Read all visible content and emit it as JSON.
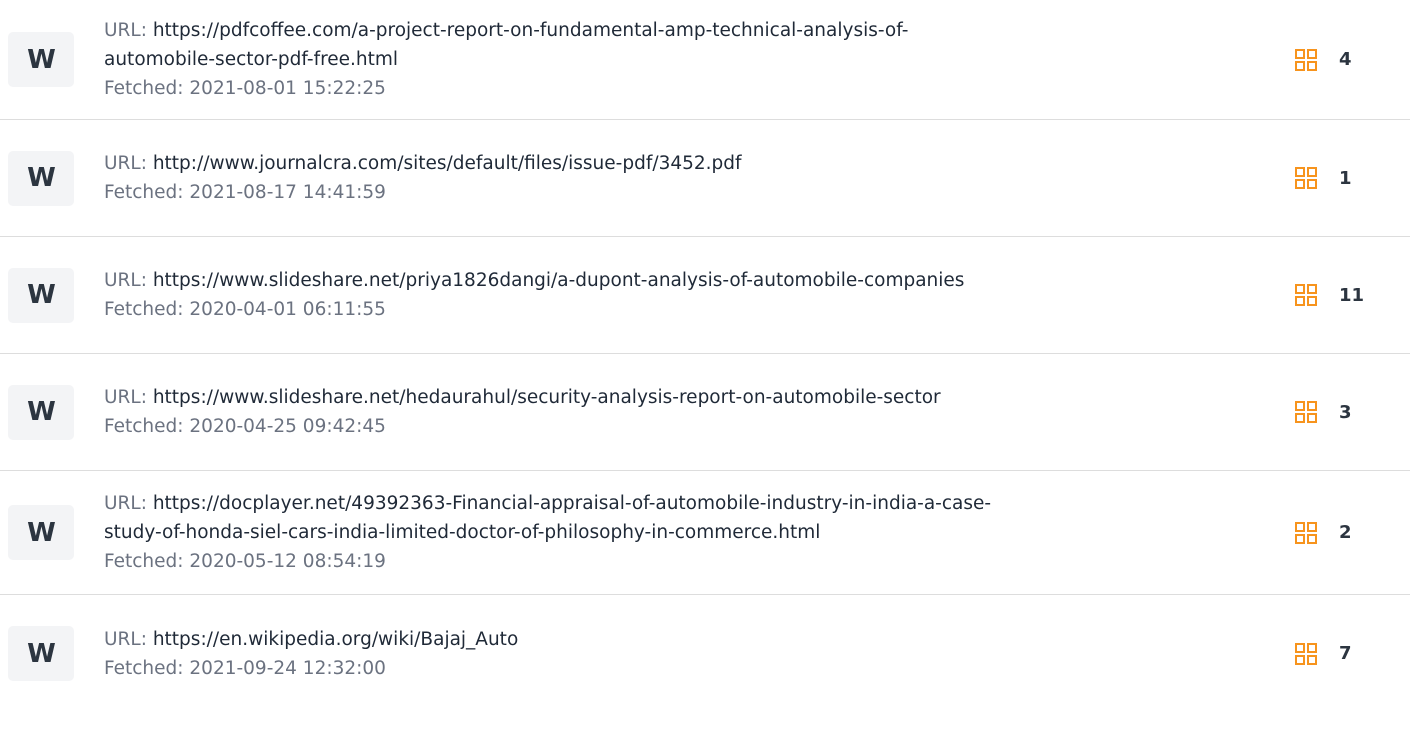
{
  "labels": {
    "url_prefix": "URL: ",
    "fetched_prefix": "Fetched: "
  },
  "accent_color": "#f7941d",
  "icons": {
    "source_badge": "W",
    "match_icon": "grid-icon"
  },
  "sources": [
    {
      "url_line1": "https://pdfcoffee.com/a-project-report-on-fundamental-amp-technical-analysis-of-",
      "url_line2": "automobile-sector-pdf-free.html",
      "fetched": "2021-08-01 15:22:25",
      "count": "4"
    },
    {
      "url_line1": "http://www.journalcra.com/sites/default/files/issue-pdf/3452.pdf",
      "fetched": "2021-08-17 14:41:59",
      "count": "1"
    },
    {
      "url_line1": "https://www.slideshare.net/priya1826dangi/a-dupont-analysis-of-automobile-companies",
      "fetched": "2020-04-01 06:11:55",
      "count": "11"
    },
    {
      "url_line1": "https://www.slideshare.net/hedaurahul/security-analysis-report-on-automobile-sector",
      "fetched": "2020-04-25 09:42:45",
      "count": "3"
    },
    {
      "url_line1": "https://docplayer.net/49392363-Financial-appraisal-of-automobile-industry-in-india-a-case-",
      "url_line2": "study-of-honda-siel-cars-india-limited-doctor-of-philosophy-in-commerce.html",
      "fetched": "2020-05-12 08:54:19",
      "count": "2"
    },
    {
      "url_line1": "https://en.wikipedia.org/wiki/Bajaj_Auto",
      "fetched": "2021-09-24 12:32:00",
      "count": "7"
    }
  ]
}
